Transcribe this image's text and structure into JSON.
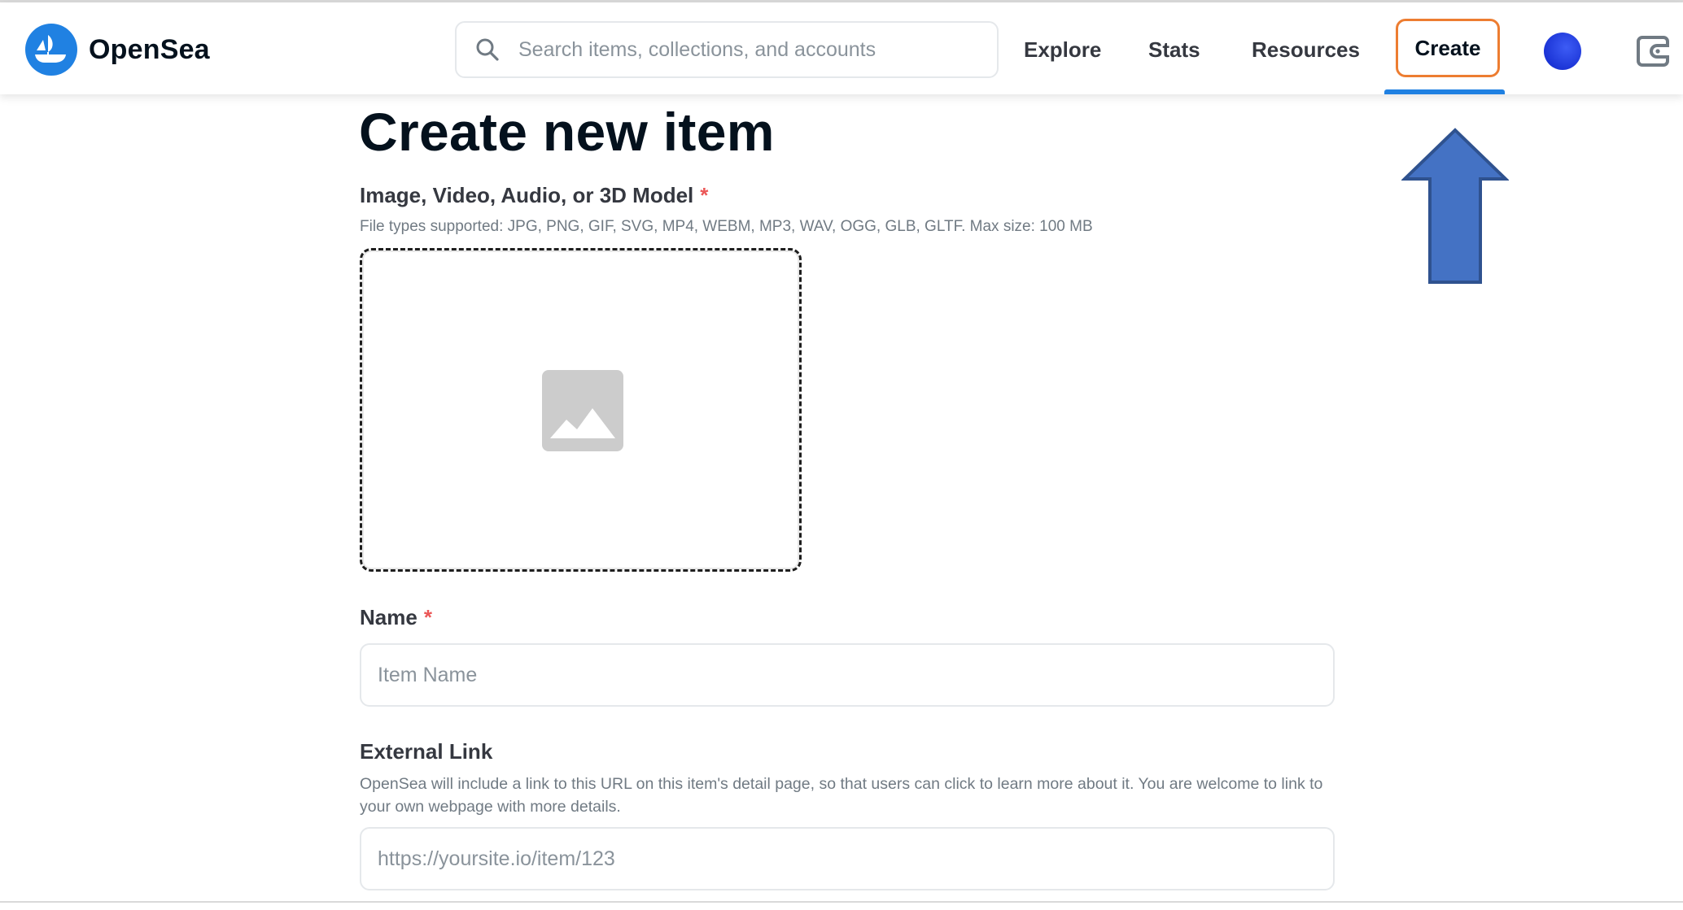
{
  "header": {
    "brand": "OpenSea",
    "search": {
      "placeholder": "Search items, collections, and accounts",
      "value": ""
    },
    "nav": {
      "explore": "Explore",
      "stats": "Stats",
      "resources": "Resources",
      "create": "Create"
    },
    "active_nav": "create"
  },
  "main": {
    "title": "Create new item",
    "media": {
      "label": "Image, Video, Audio, or 3D Model",
      "required_mark": "*",
      "hint": "File types supported: JPG, PNG, GIF, SVG, MP4, WEBM, MP3, WAV, OGG, GLB, GLTF. Max size: 100 MB",
      "placeholder_icon": "image-icon"
    },
    "name": {
      "label": "Name",
      "required_mark": "*",
      "placeholder": "Item Name",
      "value": ""
    },
    "external_link": {
      "label": "External Link",
      "description": "OpenSea will include a link to this URL on this item's detail page, so that users can click to learn more about it. You are welcome to link to your own webpage with more details.",
      "placeholder": "https://yoursite.io/item/123",
      "value": ""
    }
  },
  "icons": {
    "logo": "opensea-logo-icon",
    "search": "search-icon",
    "avatar": "avatar",
    "wallet": "wallet-icon",
    "annotation": "up-arrow-icon"
  },
  "colors": {
    "brand_blue": "#2081e2",
    "highlight_orange": "#ed7d31",
    "annotation_arrow": "#4472c4",
    "required_red": "#eb5757"
  }
}
